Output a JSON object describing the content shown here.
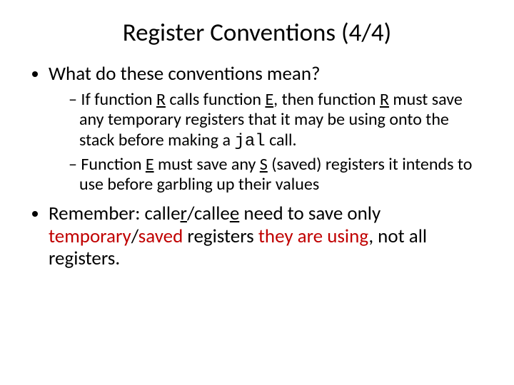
{
  "title": {
    "t1": "Register Conventions (4/4)"
  },
  "b1": {
    "q": "What do these conventions mean?",
    "s1a": "If function ",
    "s1b": "R",
    "s1c": " calls function ",
    "s1d": "E",
    "s1e": ", then function ",
    "s1f": "R",
    "s1g": " must save any temporary registers that it may be using onto the stack before making a ",
    "s1h": "jal",
    "s1i": " call.",
    "s2a": "Function ",
    "s2b": "E",
    "s2c": " must save any ",
    "s2d": "S",
    "s2e": " (saved) registers it intends to use before garbling up their values"
  },
  "b2": {
    "r1": "Remember: calle",
    "r2": "r",
    "r3": "/calle",
    "r4": "e",
    "r5": " need to save only ",
    "r6": "temporary",
    "r7": "/",
    "r8": "saved",
    "r9": " registers ",
    "r10": "they are using",
    "r11": ", not all registers."
  }
}
